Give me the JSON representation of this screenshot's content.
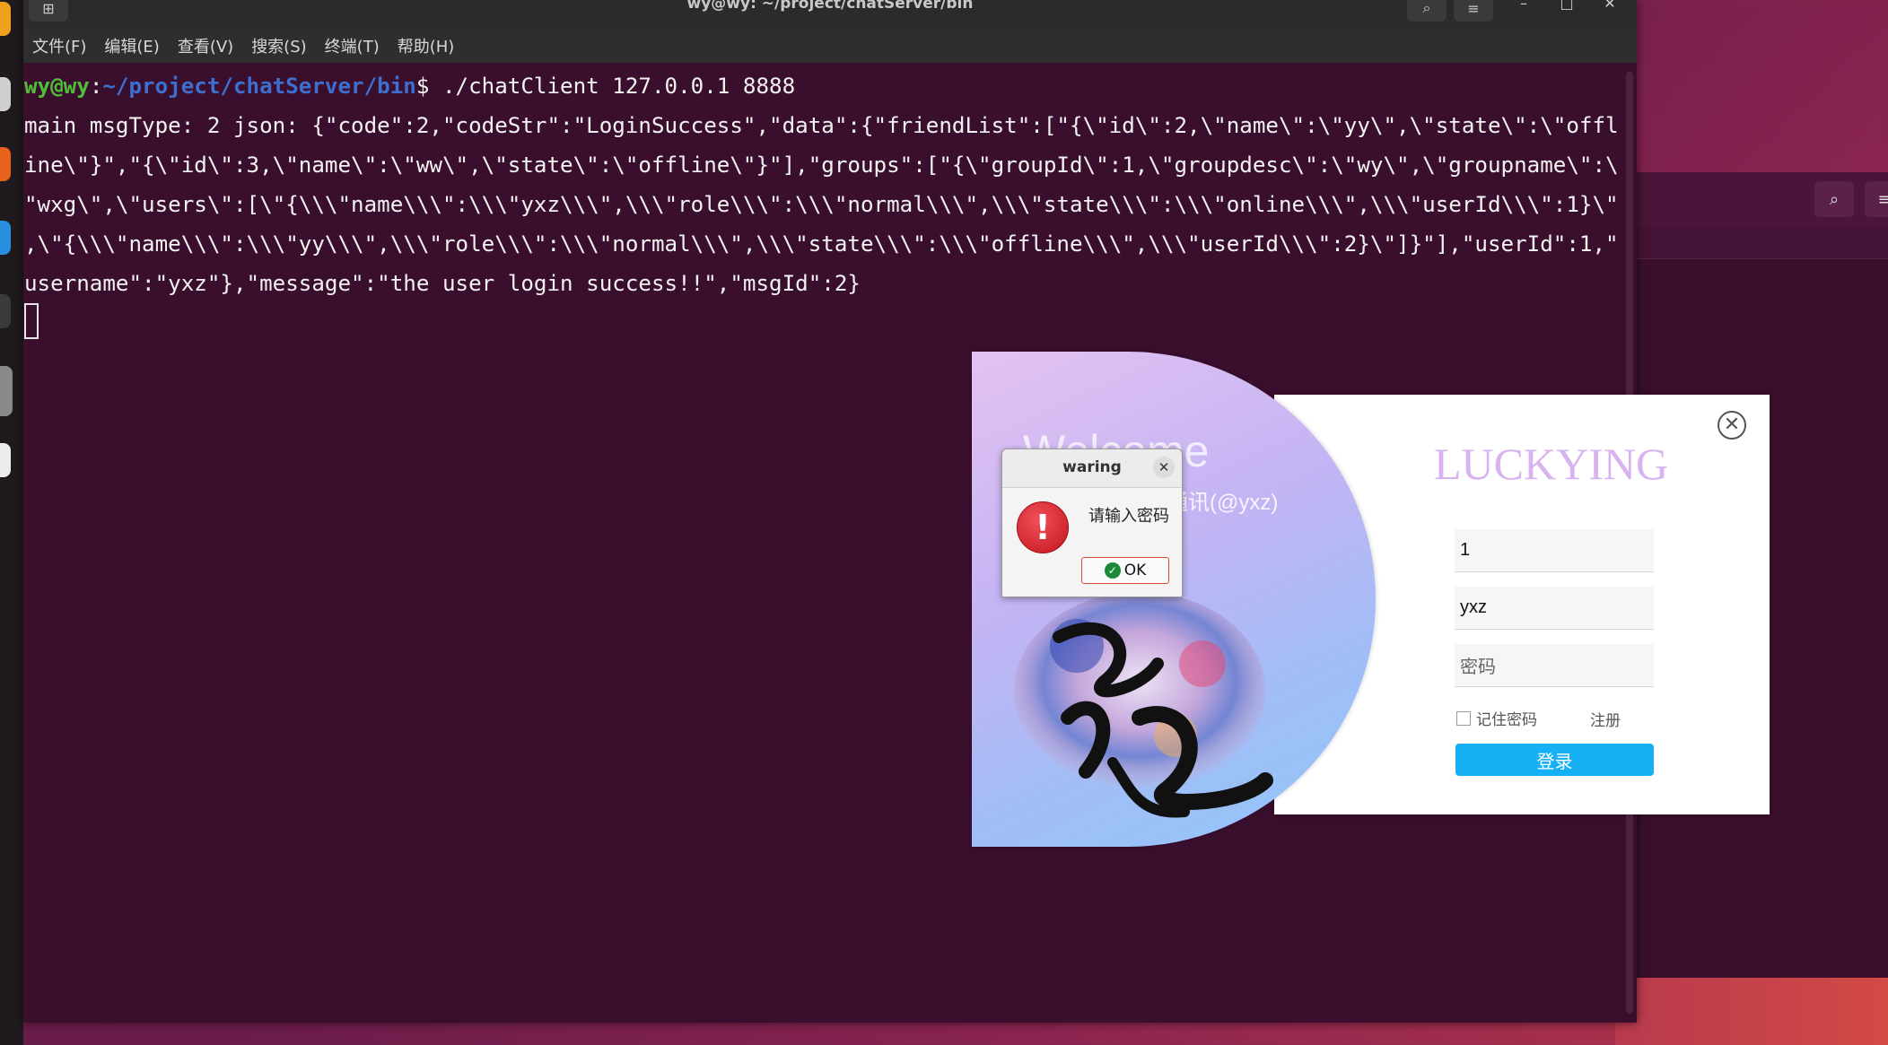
{
  "terminal": {
    "title": "wy@wy: ~/project/chatServer/bin",
    "menu": [
      "文件(F)",
      "编辑(E)",
      "查看(V)",
      "搜索(S)",
      "终端(T)",
      "帮助(H)"
    ],
    "prompt_user": "wy@wy",
    "prompt_sep": ":",
    "prompt_path": "~/project/chatServer/bin",
    "prompt_dollar": "$ ",
    "command": "./chatClient 127.0.0.1 8888",
    "output_lines": [
      "main msgType: 2 json: {\"code\":2,\"codeStr\":\"LoginSuccess\",\"data\":{\"friendList\":[\"{\\\"id\\\":2,\\\"name\\\":\\\"yy\\\",\\\"state\\\":\\\"offl",
      "ine\\\"}\",\"{\\\"id\\\":3,\\\"name\\\":\\\"ww\\\",\\\"state\\\":\\\"offline\\\"}\"],\"groups\":[\"{\\\"groupId\\\":1,\\\"groupdesc\\\":\\\"wy\\\",\\\"groupname\\\":\\",
      "\"wxg\\\",\\\"users\\\":[\\\"{\\\\\\\"name\\\\\\\":\\\\\\\"yxz\\\\\\\",\\\\\\\"role\\\\\\\":\\\\\\\"normal\\\\\\\",\\\\\\\"state\\\\\\\":\\\\\\\"online\\\\\\\",\\\\\\\"userId\\\\\\\":1}\\\"",
      ",\\\"{\\\\\\\"name\\\\\\\":\\\\\\\"yy\\\\\\\",\\\\\\\"role\\\\\\\":\\\\\\\"normal\\\\\\\",\\\\\\\"state\\\\\\\":\\\\\\\"offline\\\\\\\",\\\\\\\"userId\\\\\\\":2}\\\"]}\"],\"userId\":1,\"",
      "username\":\"yxz\"},\"message\":\"the user login success!!\",\"msgId\":2}"
    ]
  },
  "login_window": {
    "welcome": "Welcome",
    "welcome_sub": "通讯(@yxz)",
    "brand": "LUCKYING",
    "userid_value": "1",
    "username_value": "yxz",
    "password_placeholder": "密码",
    "remember_label": "记住密码",
    "register_label": "注册",
    "login_button": "登录"
  },
  "dialog": {
    "title": "waring",
    "message": "请输入密码",
    "ok_label": "OK"
  }
}
